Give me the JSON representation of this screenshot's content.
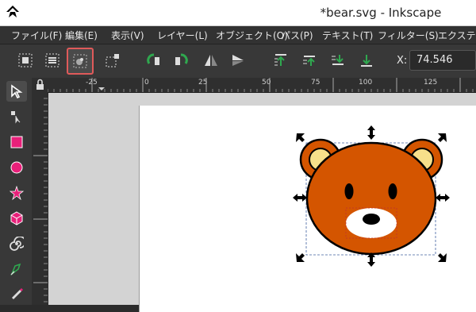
{
  "window": {
    "title": "*bear.svg - Inkscape"
  },
  "menu": {
    "items": [
      "ファイル(F)",
      "編集(E)",
      "表示(V)",
      "レイヤー(L)",
      "オブジェクト(O)",
      "パス(P)",
      "テキスト(T)",
      "フィルター(S)",
      "エクステン"
    ]
  },
  "toolbar": {
    "buttons": [
      "select-all-icon",
      "select-all-layers-icon",
      "select-same-icon",
      "deselect-icon",
      "rotate-ccw-icon",
      "rotate-cw-icon",
      "flip-horizontal-icon",
      "flip-vertical-icon",
      "raise-to-top-icon",
      "raise-icon",
      "lower-icon",
      "lower-to-bottom-icon"
    ],
    "highlighted": "select-same-icon",
    "x_label": "X:",
    "x_value": "74.546"
  },
  "rulers": {
    "horizontal_labels": [
      "-25",
      "0",
      "25",
      "50",
      "75",
      "100",
      "125"
    ]
  },
  "tools": [
    "selector-icon",
    "node-tool-icon",
    "rectangle-tool-icon",
    "ellipse-tool-icon",
    "star-tool-icon",
    "3d-box-tool-icon",
    "spiral-tool-icon",
    "pen-tool-icon",
    "pencil-tool-icon"
  ],
  "colors": {
    "bear_fur": "#d45500",
    "ear_inner": "#f7e08a",
    "highlight_border": "#e05a5a",
    "rectangle_tool": "#e8207a"
  }
}
